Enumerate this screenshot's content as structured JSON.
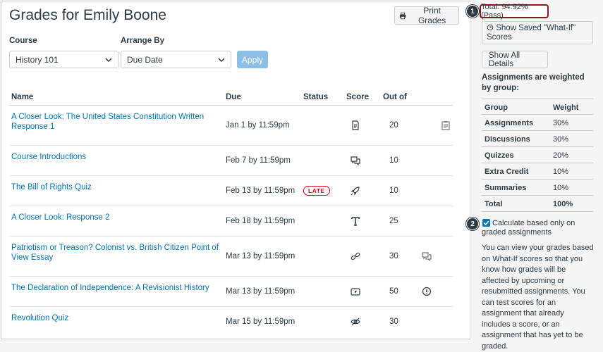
{
  "page": {
    "title": "Grades for Emily Boone",
    "print_label": "Print Grades"
  },
  "filters": {
    "course_label": "Course",
    "course_value": "History 101",
    "arrange_label": "Arrange By",
    "arrange_value": "Due Date",
    "apply_label": "Apply"
  },
  "table": {
    "headers": {
      "name": "Name",
      "due": "Due",
      "status": "Status",
      "score": "Score",
      "outof": "Out of"
    },
    "rows": [
      {
        "name": "A Closer Look: The United States Constitution Written Response 1",
        "due": "Jan 1 by 11:59pm",
        "status": "",
        "score_icon": "assignment-icon",
        "outof": "20",
        "extra_icon": "rubric-icon"
      },
      {
        "name": "Course Introductions",
        "due": "Feb 7 by 11:59pm",
        "status": "",
        "score_icon": "discussion-icon",
        "outof": "10",
        "extra_icon": ""
      },
      {
        "name": "The Bill of Rights Quiz",
        "due": "Feb 13 by 11:59pm",
        "status": "LATE",
        "score_icon": "quiz-rocket-icon",
        "outof": "10",
        "extra_icon": ""
      },
      {
        "name": "A Closer Look: Response 2",
        "due": "Feb 18 by 11:59pm",
        "status": "",
        "score_icon": "text-entry-icon",
        "outof": "25",
        "extra_icon": ""
      },
      {
        "name": "Patriotism or Treason? Colonist vs. British Citizen Point of View Essay",
        "due": "Mar 13 by 11:59pm",
        "status": "",
        "score_icon": "link-icon",
        "outof": "30",
        "extra_icon": "comments-icon"
      },
      {
        "name": "The Declaration of Independence: A Revisionist History",
        "due": "Mar 13 by 11:59pm",
        "status": "",
        "score_icon": "media-icon",
        "outof": "50",
        "extra_icon": "warning-icon"
      },
      {
        "name": "Revolution Quiz",
        "due": "Mar 15 by 11:59pm",
        "status": "",
        "score_icon": "hidden-eye-icon",
        "outof": "30",
        "extra_icon": ""
      }
    ]
  },
  "sidebar": {
    "total": "Total: 94.92% (Pass)",
    "callout_1": "1",
    "callout_2": "2",
    "whatif_label": "Show Saved \"What-If\" Scores",
    "show_details_label": "Show All Details",
    "weighted_heading": "Assignments are weighted by group:",
    "weights_header": {
      "group": "Group",
      "weight": "Weight"
    },
    "weights": [
      {
        "group": "Assignments",
        "weight": "30%"
      },
      {
        "group": "Discussions",
        "weight": "30%"
      },
      {
        "group": "Quizzes",
        "weight": "20%"
      },
      {
        "group": "Extra Credit",
        "weight": "10%"
      },
      {
        "group": "Summaries",
        "weight": "10%"
      },
      {
        "group": "Total",
        "weight": "100%"
      }
    ],
    "calc_label": "Calculate based only on graded assignments",
    "description": "You can view your grades based on What-If scores so that you know how grades will be affected by upcoming or resubmitted assignments. You can test scores for an assignment that already includes a score, or an assignment that has yet to be graded."
  },
  "colors": {
    "link": "#0374b5",
    "late": "#e0061f",
    "highlight": "#8b1a1a",
    "apply_disabled": "#8cbfe3"
  }
}
